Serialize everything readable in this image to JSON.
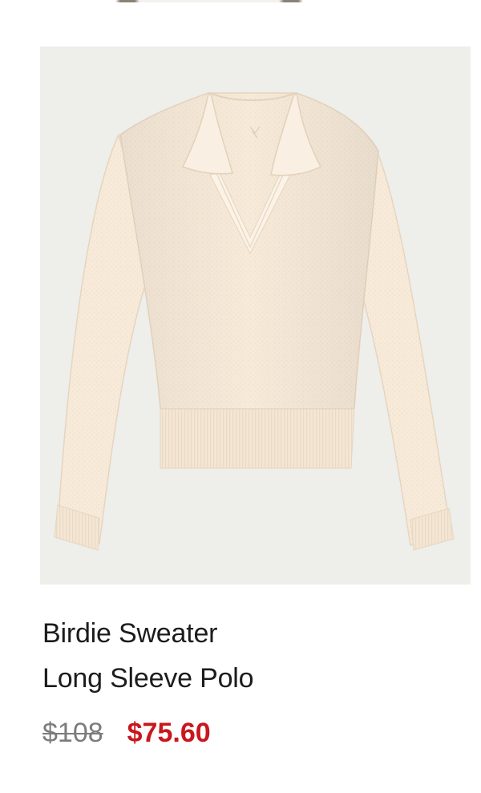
{
  "product": {
    "image_alt": "Birdie Sweater Long Sleeve Polo",
    "title_line1": "Birdie Sweater",
    "title_line2": "Long Sleeve Polo",
    "price_original": "$108",
    "price_sale": "$75.60"
  },
  "colors": {
    "image_background": "#eeeeea",
    "sweater": "#f7ead9",
    "sale_price": "#c8171d",
    "original_price": "#7c7c7c",
    "title_text": "#1c1c1c"
  }
}
